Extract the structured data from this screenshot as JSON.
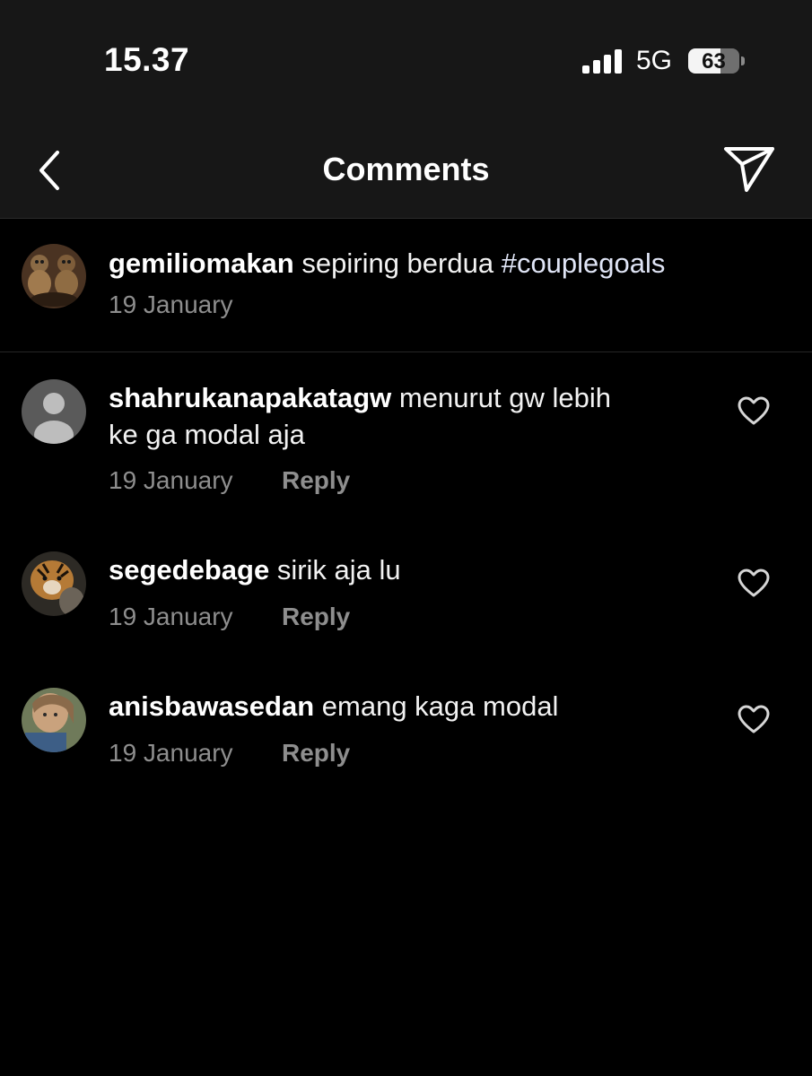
{
  "status_bar": {
    "time": "15.37",
    "network": "5G",
    "battery": "63"
  },
  "header": {
    "title": "Comments",
    "back_icon": "chevron-left-icon",
    "share_icon": "send-icon"
  },
  "caption": {
    "username": "gemiliomakan",
    "text": "sepiring berdua",
    "hashtag": "#couplegoals",
    "date": "19 January"
  },
  "comments": [
    {
      "username": "shahrukanapakatagw",
      "text": "menurut gw lebih",
      "text_line2": "ke ga modal aja",
      "date": "19 January",
      "reply": "Reply"
    },
    {
      "username": "segedebage",
      "text": "sirik aja lu",
      "date": "19 January",
      "reply": "Reply"
    },
    {
      "username": "anisbawasedan",
      "text": "emang kaga modal",
      "date": "19 January",
      "reply": "Reply"
    }
  ],
  "colors": {
    "background": "#000000",
    "header": "#171717",
    "muted_text": "#8e8e8e",
    "hashtag": "#e0e5f6"
  }
}
